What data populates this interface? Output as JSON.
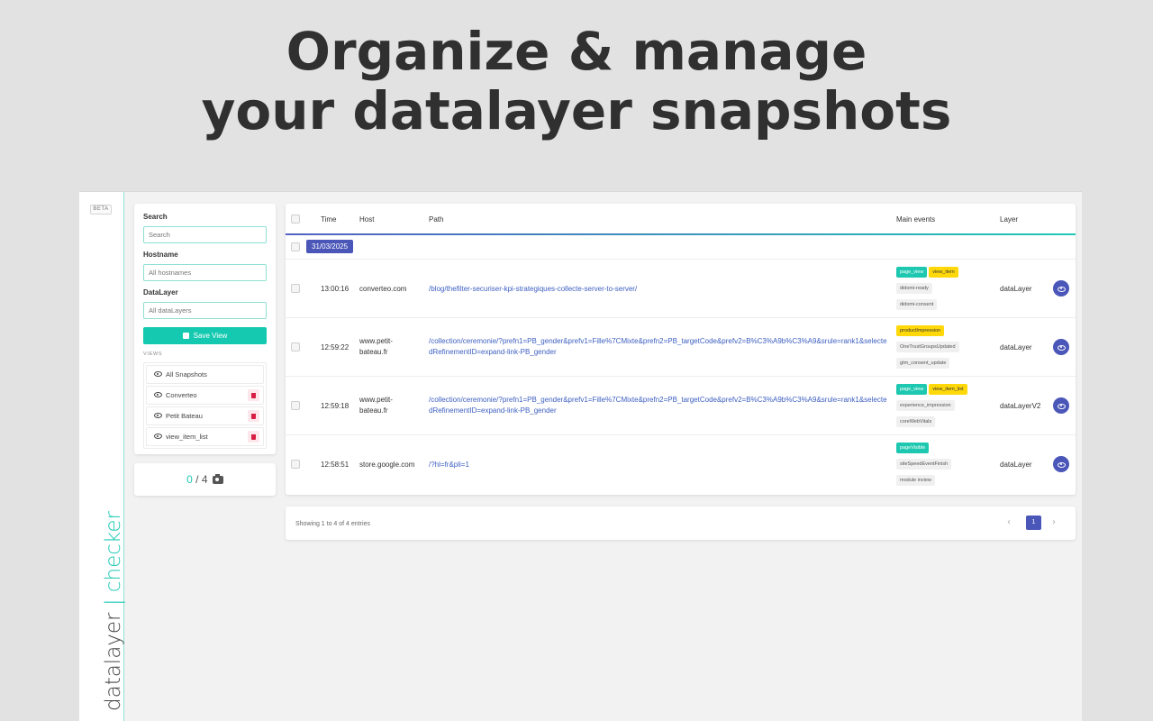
{
  "headline": {
    "line1": "Organize & manage",
    "line2": "your datalayer snapshots"
  },
  "rail": {
    "beta": "BETA",
    "brand_part1": "datalayer",
    "brand_sep": "|",
    "brand_part2": "checker"
  },
  "filters": {
    "search_label": "Search",
    "search_placeholder": "Search",
    "hostname_label": "Hostname",
    "hostname_placeholder": "All hostnames",
    "datalayer_label": "DataLayer",
    "datalayer_placeholder": "All dataLayers",
    "save_label": "Save View",
    "views_label": "VIEWS",
    "views": [
      {
        "label": "All Snapshots",
        "deletable": false
      },
      {
        "label": "Converteo",
        "deletable": true
      },
      {
        "label": "Petit Bateau",
        "deletable": true
      },
      {
        "label": "view_item_list",
        "deletable": true
      }
    ]
  },
  "counter": {
    "current": "0",
    "sep": " / ",
    "total": "4",
    "icon": "camera-icon"
  },
  "table": {
    "headers": {
      "time": "Time",
      "host": "Host",
      "path": "Path",
      "events": "Main events",
      "layer": "Layer"
    },
    "date": "31/03/2025",
    "rows": [
      {
        "time": "13:00:16",
        "host": "converteo.com",
        "path": "/blog/thefilter-securiser-kpi-strategiques-collecte-server-to-server/",
        "events": [
          {
            "label": "page_view",
            "color": "teal"
          },
          {
            "label": "view_item",
            "color": "yellow"
          },
          {
            "label": "didomi-ready",
            "color": "gray"
          },
          {
            "label": "didomi-consent",
            "color": "gray"
          }
        ],
        "layer": "dataLayer"
      },
      {
        "time": "12:59:22",
        "host": "www.petit-bateau.fr",
        "path": "/collection/ceremonie/?prefn1=PB_gender&prefv1=Fille%7CMixte&prefn2=PB_targetCode&prefv2=B%C3%A9b%C3%A9&srule=rank1&selectedRefinementID=expand-link-PB_gender",
        "events": [
          {
            "label": "productImpression",
            "color": "yellow"
          },
          {
            "label": "OneTrustGroupsUpdated",
            "color": "gray"
          },
          {
            "label": "gtm_consent_update",
            "color": "gray"
          }
        ],
        "layer": "dataLayer"
      },
      {
        "time": "12:59:18",
        "host": "www.petit-bateau.fr",
        "path": "/collection/ceremonie/?prefn1=PB_gender&prefv1=Fille%7CMixte&prefn2=PB_targetCode&prefv2=B%C3%A9b%C3%A9&srule=rank1&selectedRefinementID=expand-link-PB_gender",
        "events": [
          {
            "label": "page_view",
            "color": "teal"
          },
          {
            "label": "view_item_list",
            "color": "yellow"
          },
          {
            "label": "experience_impression",
            "color": "gray"
          },
          {
            "label": "coreWebVitals",
            "color": "gray"
          }
        ],
        "layer": "dataLayerV2"
      },
      {
        "time": "12:58:51",
        "host": "store.google.com",
        "path": "/?hl=fr&pli=1",
        "events": [
          {
            "label": "pageVisible",
            "color": "teal"
          },
          {
            "label": "siteSpeedEventFinish",
            "color": "gray"
          },
          {
            "label": "module inview",
            "color": "gray"
          }
        ],
        "layer": "dataLayer"
      }
    ]
  },
  "footer": {
    "showing": "Showing 1 to 4 of 4 entries",
    "prev": "‹",
    "page": "1",
    "next": "›"
  }
}
